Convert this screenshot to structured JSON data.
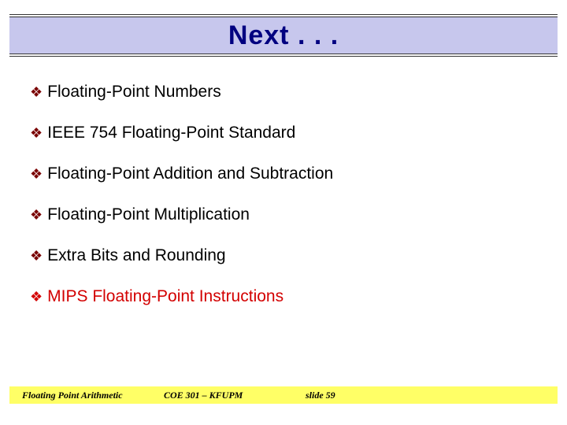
{
  "title": "Next . . .",
  "bullets": [
    {
      "text": "Floating-Point Numbers",
      "highlight": false
    },
    {
      "text": "IEEE 754 Floating-Point Standard",
      "highlight": false
    },
    {
      "text": "Floating-Point Addition and Subtraction",
      "highlight": false
    },
    {
      "text": "Floating-Point Multiplication",
      "highlight": false
    },
    {
      "text": "Extra Bits and Rounding",
      "highlight": false
    },
    {
      "text": "MIPS Floating-Point Instructions",
      "highlight": true
    }
  ],
  "footer": {
    "left": "Floating Point Arithmetic",
    "mid": "COE 301 – KFUPM",
    "right": "slide 59"
  }
}
